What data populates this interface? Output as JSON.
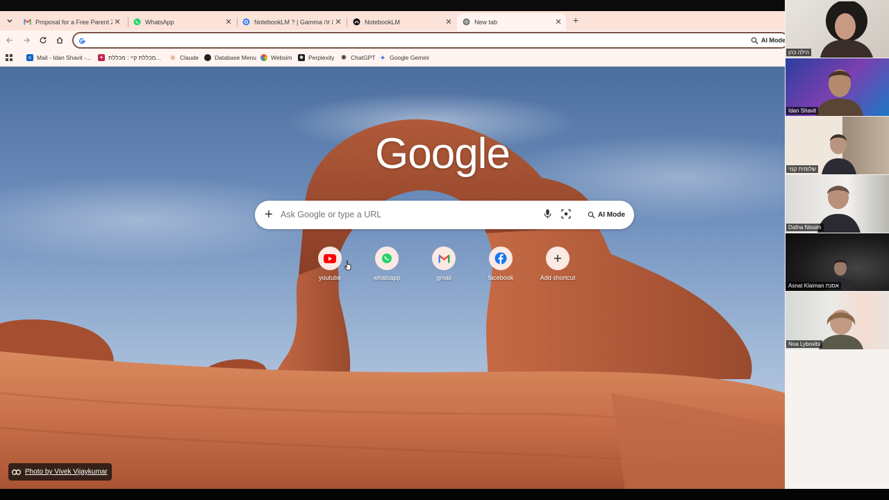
{
  "browser": {
    "tabs": [
      {
        "title": "Proposal for a Free Parent Zoom",
        "icon": "gmail-icon"
      },
      {
        "title": "WhatsApp",
        "icon": "whatsapp-icon"
      },
      {
        "title": "NotebookLM ? | Gamma מה זה",
        "icon": "google-icon"
      },
      {
        "title": "NotebookLM",
        "icon": "notebooklm-icon"
      },
      {
        "title": "New tab",
        "icon": "chrome-icon",
        "active": true
      }
    ],
    "omnibox_value": "",
    "ai_mode_label": "AI Mode"
  },
  "bookmarks": [
    {
      "label": "Mail - Idan Shavit -...",
      "icon": "outlook-icon"
    },
    {
      "label": "מכללת קיי : מכללת...",
      "icon": "college-icon"
    },
    {
      "label": "Claude",
      "icon": "claude-icon"
    },
    {
      "label": "Database Menu",
      "icon": "database-icon"
    },
    {
      "label": "Websim",
      "icon": "websim-icon"
    },
    {
      "label": "Perplexity",
      "icon": "perplexity-icon"
    },
    {
      "label": "ChatGPT",
      "icon": "chatgpt-icon"
    },
    {
      "label": "Google Gemini",
      "icon": "gemini-icon"
    }
  ],
  "ntp": {
    "logo": "Google",
    "search_placeholder": "Ask Google or type a URL",
    "ai_mode_label": "AI Mode",
    "shortcuts": [
      {
        "label": "youtube",
        "icon": "youtube-icon"
      },
      {
        "label": "whatsapp",
        "icon": "whatsapp-icon"
      },
      {
        "label": "gmail",
        "icon": "gmail-icon"
      },
      {
        "label": "facebook",
        "icon": "facebook-icon"
      },
      {
        "label": "Add shortcut",
        "icon": "plus-icon"
      }
    ],
    "photo_credit": "Photo by Vivek Vijaykumar"
  },
  "participants": [
    {
      "name": "הילה כהן"
    },
    {
      "name": "Idan Shavit"
    },
    {
      "name": "שלומית קנזי"
    },
    {
      "name": "Dafna Nissim"
    },
    {
      "name": "Asnat Klaiman אסנת"
    },
    {
      "name": "Noa Lybovits"
    }
  ],
  "colors": {
    "tabbar": "#fbe3da",
    "toolbar": "#fff4f0",
    "omnibox_border": "#7a5146"
  }
}
